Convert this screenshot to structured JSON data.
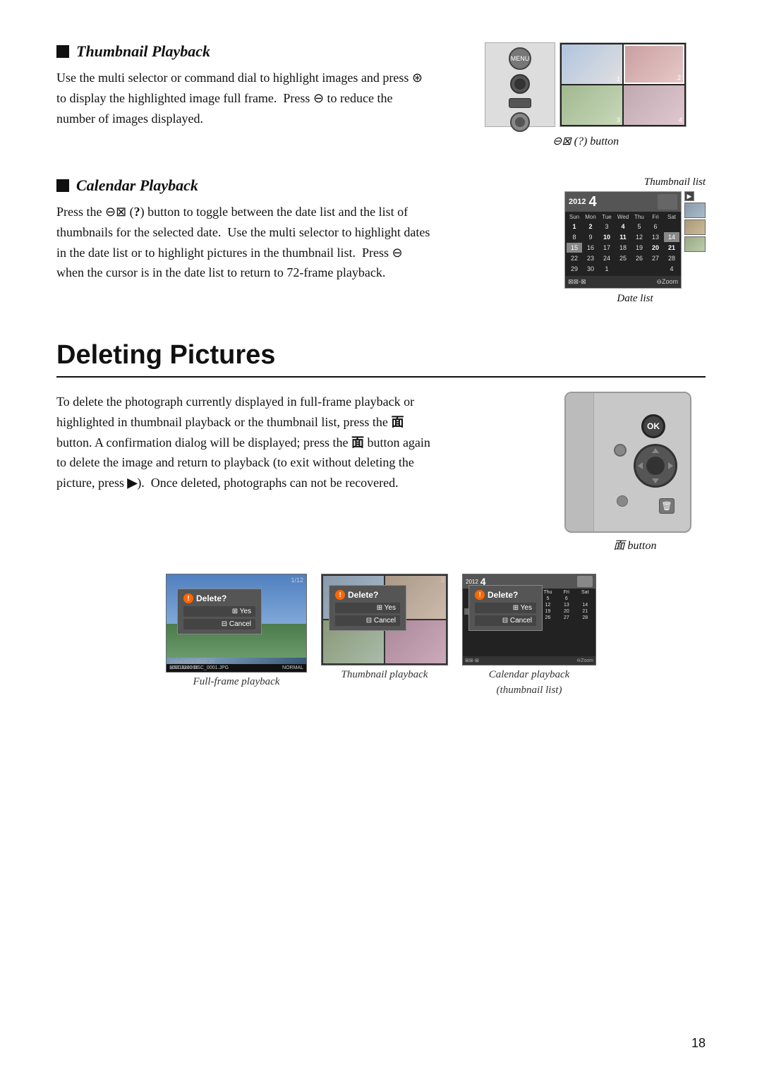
{
  "page": {
    "number": "18"
  },
  "thumbnail_playback": {
    "title": "Thumbnail Playback",
    "body": "Use the multi selector or command dial to highlight images and press ⊛ to display the highlighted image full frame.  Press ⊖ to reduce the number of images displayed.",
    "button_label": "⊖⊠ (?) button"
  },
  "calendar_playback": {
    "title": "Calendar Playback",
    "body": "Press the ⊖⊠ (?) button to toggle between the date list and the list of thumbnails for the selected date.  Use the multi selector to highlight dates in the date list or to highlight pictures in the thumbnail list.  Press ⊖ when the cursor is in the date list to return to 72-frame playback.",
    "thumbnail_list_label": "Thumbnail list",
    "date_list_label": "Date list",
    "calendar": {
      "year": "2012",
      "month": "4",
      "days_header": [
        "Sun",
        "Mon",
        "Tue",
        "Wed",
        "Thu",
        "Fri",
        "Sat"
      ],
      "weeks": [
        [
          "1",
          "2",
          "3",
          "4",
          "5",
          "6",
          ""
        ],
        [
          "8",
          "9",
          "10",
          "11",
          "12",
          "13",
          "14"
        ],
        [
          "15",
          "16",
          "17",
          "18",
          "19",
          "20",
          "21"
        ],
        [
          "22",
          "23",
          "24",
          "25",
          "26",
          "27",
          "28"
        ],
        [
          "29",
          "30",
          "1",
          "",
          "",
          "",
          "4"
        ]
      ],
      "footer_left": "⊠⊠-⊠",
      "footer_right": "⊖Zoom"
    }
  },
  "deleting_pictures": {
    "title": "Deleting Pictures",
    "body": "To delete the photograph currently displayed in full-frame playback or highlighted in thumbnail playback or the thumbnail list, press the 面 button. A confirmation dialog will be displayed; press the 面 button again to delete the image and return to playback (to exit without deleting the picture, press ▶).  Once deleted, photographs can not be recovered.",
    "trash_button_label": "面 button"
  },
  "screenshots": {
    "fullframe": {
      "caption": "Full-frame playback",
      "number": "1/12",
      "dialog": {
        "title": "Delete?",
        "yes": "⊞ Yes",
        "cancel": "⊟ Cancel"
      },
      "meta": {
        "left": "100D3200   DSC_0001.JPG",
        "right": "NORMAL",
        "date": "15/04/2012  10:02:27",
        "size": "⊠5016x4000"
      }
    },
    "thumbnail": {
      "caption": "Thumbnail playback",
      "number": "2",
      "dialog": {
        "title": "Delete?",
        "yes": "⊞ Yes",
        "cancel": "⊟ Cancel"
      }
    },
    "calendar": {
      "caption": "Calendar playback\n(thumbnail list)",
      "caption_line1": "Calendar playback",
      "caption_line2": "(thumbnail list)",
      "dialog": {
        "title": "Delete?",
        "yes": "⊞ Yes",
        "cancel": "⊟ Cancel"
      },
      "year": "2012",
      "month": "4"
    }
  }
}
